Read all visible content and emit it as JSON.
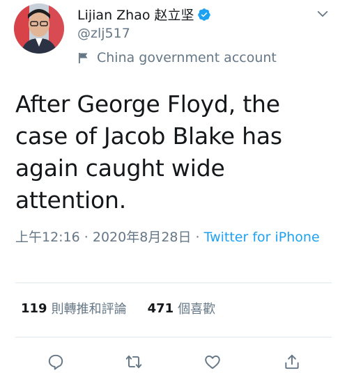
{
  "tweet": {
    "author": {
      "name": "Lijian Zhao 赵立坚",
      "handle": "@zlj517",
      "label": "China government account",
      "avatar_icon": "avatar"
    },
    "text": "After George Floyd, the case of Jacob Blake has again caught wide attention.",
    "timestamp": "上午12:16 · 2020年8月28日",
    "separator": " · ",
    "source": "Twitter for iPhone",
    "stats": {
      "retweets_count": "119",
      "retweets_label": "則轉推和評論",
      "likes_count": "471",
      "likes_label": "個喜歡"
    },
    "actions": [
      "reply-icon",
      "retweet-icon",
      "like-icon",
      "share-icon"
    ]
  },
  "colors": {
    "text": "#14171a",
    "muted": "#657786",
    "accent": "#1da1f2",
    "divider": "#e1e8ed"
  }
}
